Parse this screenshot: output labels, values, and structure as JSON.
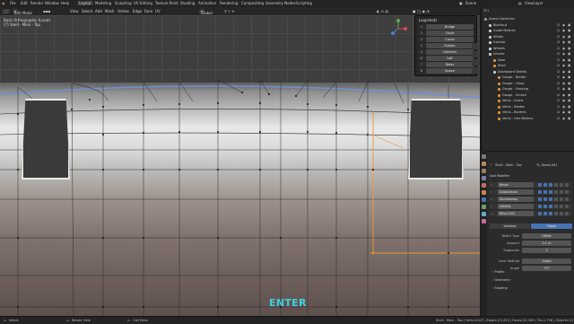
{
  "menubar": {
    "menus": [
      "File",
      "Edit",
      "Render",
      "Window",
      "Help"
    ],
    "workspaces": [
      "Layout",
      "Modeling",
      "Sculpting",
      "UV Editing",
      "Texture Paint",
      "Shading",
      "Animation",
      "Rendering",
      "Compositing",
      "Geometry Nodes",
      "Scripting"
    ],
    "active_workspace": "Layout",
    "scene": "Scene",
    "view_layer": "ViewLayer"
  },
  "viewport_header": {
    "mode": "Edit Mode",
    "menus": [
      "View",
      "Select",
      "Add",
      "Mesh",
      "Vertex",
      "Edge",
      "Face",
      "UV"
    ],
    "transform": "Global"
  },
  "viewport": {
    "view_name": "Back Orthographic (Local)",
    "object_name": "(7) Shell - Main - Top",
    "overlay_text": "ENTER"
  },
  "loopshots": {
    "title": "Loopshots",
    "items": [
      {
        "key": "1",
        "label": "Bridge"
      },
      {
        "key": "2",
        "label": "Circle"
      },
      {
        "key": "3",
        "label": "Curve"
      },
      {
        "key": "4",
        "label": "Flatten"
      },
      {
        "key": "5",
        "label": "Gstretch"
      },
      {
        "key": "6",
        "label": "Loft"
      },
      {
        "key": "7",
        "label": "Relax"
      },
      {
        "key": "8",
        "label": "Space"
      }
    ]
  },
  "outliner": {
    "rows": [
      {
        "label": "Scene Collection",
        "indent": 0,
        "color": "#9a9a9a"
      },
      {
        "label": "Blockout",
        "indent": 1,
        "color": "#cccccc"
      },
      {
        "label": "Guide Meshes",
        "indent": 1,
        "color": "#cccccc"
      },
      {
        "label": "Kitbits",
        "indent": 1,
        "color": "#cccccc"
      },
      {
        "label": "Exterior",
        "indent": 1,
        "color": "#cccccc"
      },
      {
        "label": "Wheels",
        "indent": 1,
        "color": "#cccccc"
      },
      {
        "label": "Interior",
        "indent": 1,
        "color": "#cccccc"
      },
      {
        "label": "Door",
        "indent": 2,
        "color": "#e08f3c"
      },
      {
        "label": "Shell",
        "indent": 2,
        "color": "#e08f3c"
      },
      {
        "label": "Dashboard Details",
        "indent": 2,
        "color": "#cccccc"
      },
      {
        "label": "Gauge - Border",
        "indent": 3,
        "color": "#e08f3c"
      },
      {
        "label": "Gauge - Glass",
        "indent": 3,
        "color": "#e08f3c"
      },
      {
        "label": "Gauge - Housing",
        "indent": 3,
        "color": "#e08f3c"
      },
      {
        "label": "Gauge - Screen",
        "indent": 3,
        "color": "#e08f3c"
      },
      {
        "label": "Vents - Arrow",
        "indent": 3,
        "color": "#e08f3c"
      },
      {
        "label": "Vents - Blades",
        "indent": 3,
        "color": "#e08f3c"
      },
      {
        "label": "Vents - Borders",
        "indent": 3,
        "color": "#e08f3c"
      },
      {
        "label": "Vents - Hex Meshes",
        "indent": 3,
        "color": "#e08f3c"
      }
    ]
  },
  "properties": {
    "object_name": "Shell - Main - Top",
    "modifier_ref": "Bevel.001",
    "add_modifier": "Add Modifier",
    "modifiers": [
      "Bevel",
      "Subdivision",
      "Shrinkwrap",
      "Solidify",
      "Bevel.001"
    ],
    "affect_options": [
      "Vertices",
      "Edges"
    ],
    "affect_selected": "Edges",
    "fields": [
      {
        "label": "Width Type",
        "value": "Offset"
      },
      {
        "label": "Amount",
        "value": "0.1 m"
      },
      {
        "label": "Segments",
        "value": "3"
      },
      {
        "label": "Limit Method",
        "value": "Angle"
      },
      {
        "label": "Angle",
        "value": "70°"
      }
    ],
    "sections": [
      "Profile",
      "Geometry",
      "Shading"
    ]
  },
  "status": {
    "select": "Select",
    "rotate": "Rotate View",
    "menu": "Call Menu",
    "info": "Shell - Main - Top | Verts:4/447 | Edges:2/1,815 | Faces:0/1,360 | Tris:1,758 | Objects:1/1"
  },
  "colors": {
    "accent": "#4772b3",
    "enter_text": "#3cd2e0",
    "selected_edge": "#e69a3a"
  }
}
